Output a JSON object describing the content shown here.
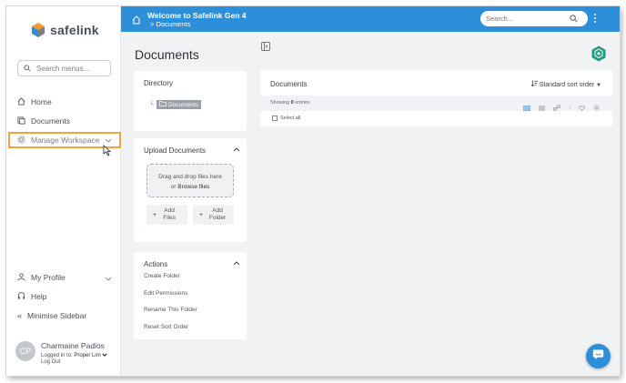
{
  "brand": {
    "name": "safelink"
  },
  "sidebar": {
    "search_placeholder": "Search menus...",
    "items": [
      {
        "label": "Home"
      },
      {
        "label": "Documents"
      },
      {
        "label": "Manage Workspace"
      }
    ],
    "bottom_items": [
      {
        "label": "My Profile"
      },
      {
        "label": "Help"
      },
      {
        "label": "Minimise Sidebar"
      }
    ],
    "user": {
      "initials": "CP",
      "name": "Charmaine Padios",
      "logged_in_label": "Logged in to:",
      "workspace": "Proper Lim",
      "logout": "Log Out"
    }
  },
  "header": {
    "title": "Welcome to Safelink Gen 4",
    "breadcrumb": "> Documents",
    "search_placeholder": "Search..."
  },
  "page": {
    "title": "Documents"
  },
  "directory": {
    "title": "Directory",
    "selected_folder": "Documents"
  },
  "upload": {
    "title": "Upload Documents",
    "drop_text": "Drag and drop files here",
    "or_text": "or",
    "browse_text": "Browse files",
    "add_files": "Add Files",
    "add_folder": "Add Folder"
  },
  "actions": {
    "title": "Actions",
    "items": [
      "Create Folder",
      "Edit Permissions",
      "Rename This Folder",
      "Reset Sort Order"
    ]
  },
  "documents": {
    "title": "Documents",
    "sort_label": "Standard sort order",
    "showing_prefix": "Showing",
    "count": "0",
    "showing_suffix": "entries",
    "select_all": "Select all"
  },
  "colors": {
    "primary": "#2d8fd9",
    "highlight": "#f0a443",
    "badge": "#1e9e7e",
    "logo_orange": "#f39a2a",
    "logo_blue": "#2d8fd9"
  }
}
